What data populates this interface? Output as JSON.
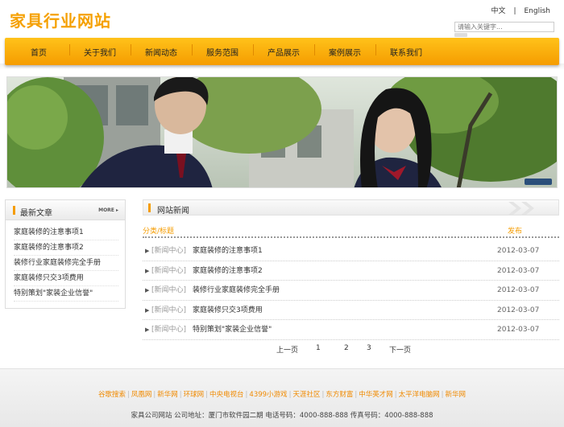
{
  "site": {
    "logo": "家具行业网站"
  },
  "lang": {
    "cn": "中文",
    "sep": "|",
    "en": "English"
  },
  "search": {
    "placeholder": "请输入关键字..."
  },
  "nav": [
    "首页",
    "关于我们",
    "新闻动态",
    "服务范围",
    "产品展示",
    "案例展示",
    "联系我们"
  ],
  "sidebar": {
    "title": "最新文章",
    "more": "MORE ▸",
    "items": [
      "家庭装修的注意事项1",
      "家庭装修的注意事项2",
      "装修行业家庭装修完全手册",
      "家庭装修只交3项费用",
      "特别策划\"家装企业信誉\""
    ]
  },
  "news": {
    "title": "网站新闻",
    "col_title": "分类/标题",
    "col_date": "发布",
    "rows": [
      {
        "cat": "[新闻中心]",
        "title": "家庭装修的注意事项1",
        "date": "2012-03-07"
      },
      {
        "cat": "[新闻中心]",
        "title": "家庭装修的注意事项2",
        "date": "2012-03-07"
      },
      {
        "cat": "[新闻中心]",
        "title": "装修行业家庭装修完全手册",
        "date": "2012-03-07"
      },
      {
        "cat": "[新闻中心]",
        "title": "家庭装修只交3项费用",
        "date": "2012-03-07"
      },
      {
        "cat": "[新闻中心]",
        "title": "特别策划\"家装企业信誉\"",
        "date": "2012-03-07"
      }
    ],
    "pager": {
      "prev": "上一页",
      "p1": "1",
      "p2": "2",
      "p3": "3",
      "next": "下一页"
    }
  },
  "footer": {
    "links": [
      "谷歌搜索",
      "凤凰网",
      "新华网",
      "环球网",
      "中央电视台",
      "4399小游戏",
      "天涯社区",
      "东方财富",
      "中华英才网",
      "太平洋电脑网",
      "新华网"
    ],
    "sep": "|",
    "contact": "家具公司网站   公司地址：厦门市软件园二期    电话号码：4000-888-888  传真号码：4000-888-888"
  }
}
